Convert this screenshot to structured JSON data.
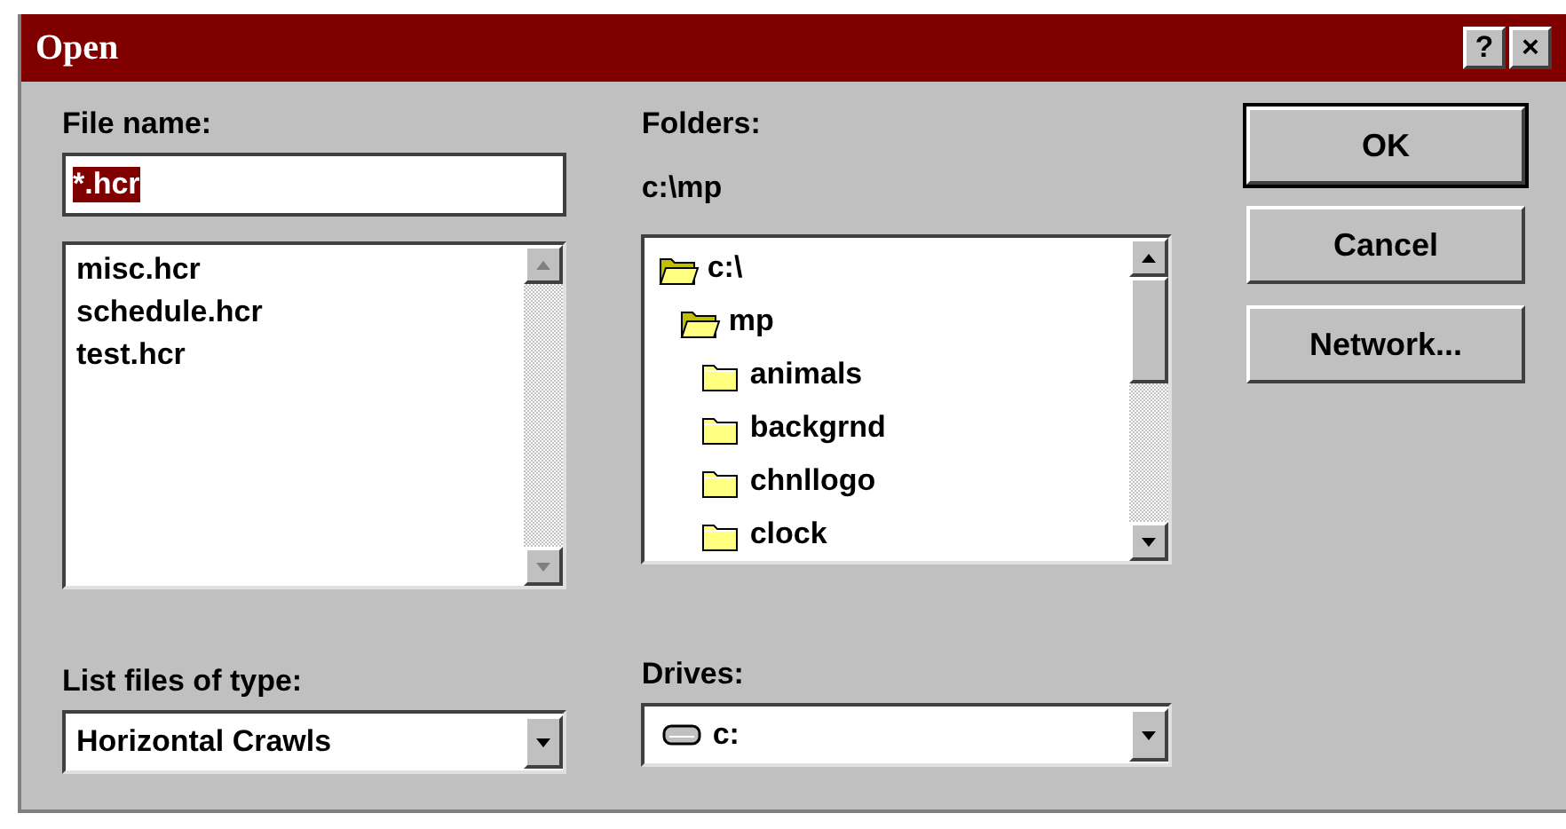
{
  "window": {
    "title": "Open",
    "controls": [
      "?",
      "×"
    ]
  },
  "file_name": {
    "label": "File name:",
    "value": "*.hcr",
    "text_selected": true
  },
  "file_list": {
    "items": [
      "misc.hcr",
      "schedule.hcr",
      "test.hcr"
    ],
    "scrollbar_enabled": false
  },
  "file_type": {
    "label": "List files of type:",
    "value": "Horizontal Crawls"
  },
  "folders": {
    "label": "Folders:",
    "path": "c:\\mp",
    "scrollbar_enabled": true,
    "tree": [
      {
        "name": "c:\\",
        "open": true,
        "children": [
          {
            "name": "mp",
            "open": true,
            "children": [
              {
                "name": "animals",
                "open": false
              },
              {
                "name": "backgrnd",
                "open": false
              },
              {
                "name": "chnllogo",
                "open": false
              },
              {
                "name": "clock",
                "open": false
              }
            ]
          }
        ]
      }
    ]
  },
  "drives": {
    "label": "Drives:",
    "value": "c:"
  },
  "buttons": [
    {
      "label": "OK",
      "default": true
    },
    {
      "label": "Cancel",
      "default": false
    },
    {
      "label": "Network...",
      "default": false
    }
  ]
}
